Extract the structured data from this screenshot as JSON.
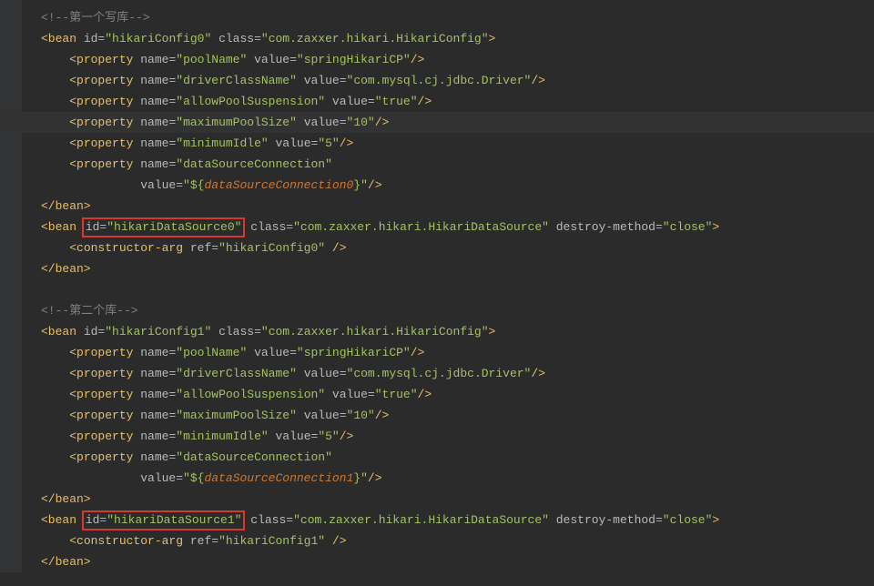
{
  "code": {
    "comment1": "<!--第一个写库-->",
    "bean0_open_pre": "<bean ",
    "bean0_id_attr": "id",
    "bean0_id_val": "\"hikariConfig0\"",
    "bean0_class_attr": " class",
    "bean0_class_val": "\"com.zaxxer.hikari.HikariConfig\"",
    "close_angle": ">",
    "prop_open": "<property ",
    "name_attr": "name",
    "value_attr": " value",
    "selfclose": "/>",
    "p0_name": "\"poolName\"",
    "p0_val": "\"springHikariCP\"",
    "p1_name": "\"driverClassName\"",
    "p1_val": "\"com.mysql.cj.jdbc.Driver\"",
    "p2_name": "\"allowPoolSuspension\"",
    "p2_val": "\"true\"",
    "p3_name": "\"maximumPoolSize\"",
    "p3_val": "\"10\"",
    "p4_name": "\"minimumIdle\"",
    "p4_val": "\"5\"",
    "p5_name": "\"dataSourceConnection\"",
    "p5_val_pre": "\"${",
    "p5_val_expr": "dataSourceConnection0",
    "p5_val_post": "}\"",
    "bean_close": "</bean>",
    "ds0_open_pre": "<bean ",
    "ds0_id_attr": "id",
    "ds0_id_val": "\"hikariDataSource0\"",
    "ds0_class_attr": " class",
    "ds0_class_val": "\"com.zaxxer.hikari.HikariDataSource\"",
    "destroy_attr": " destroy-method",
    "destroy_val": "\"close\"",
    "ctor_open": "<constructor-arg ",
    "ref_attr": "ref",
    "ctor0_val": "\"hikariConfig0\"",
    "ctor_close": " />",
    "comment2": "<!--第二个库-->",
    "bean1_id_val": "\"hikariConfig1\"",
    "p5b_val_expr": "dataSourceConnection1",
    "ds1_id_val": "\"hikariDataSource1\"",
    "ctor1_val": "\"hikariConfig1\""
  }
}
